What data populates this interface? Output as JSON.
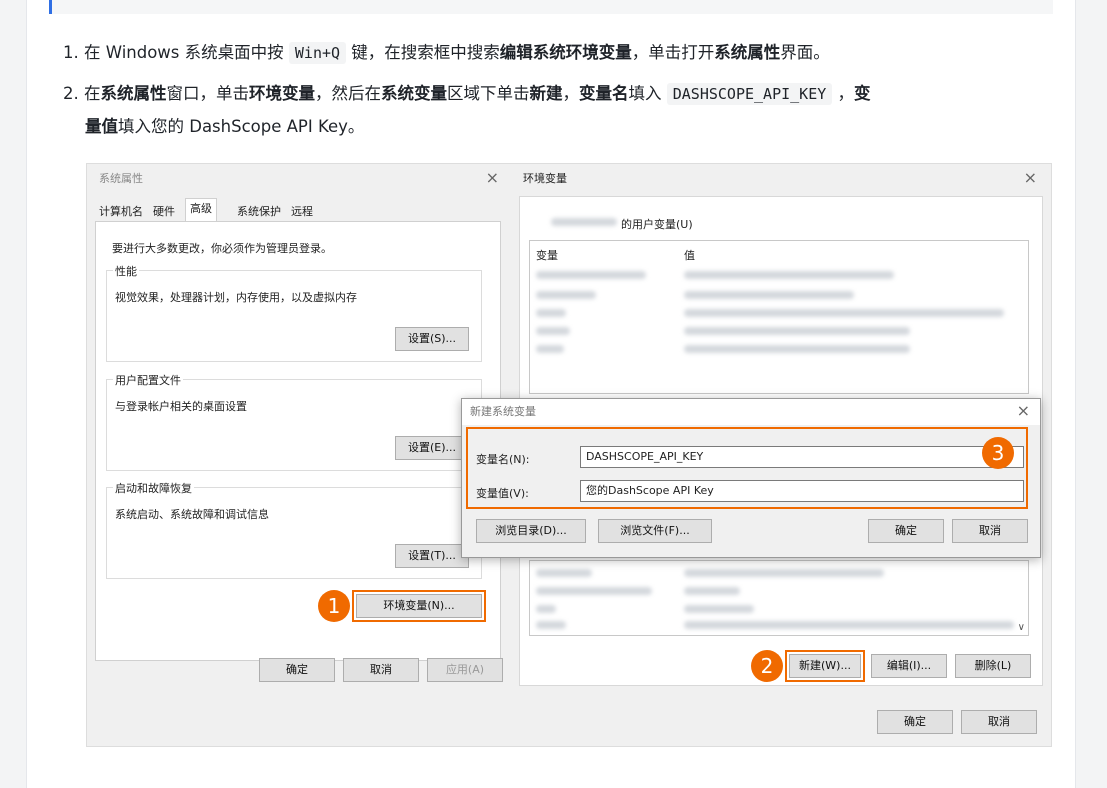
{
  "steps": [
    {
      "num": "1.",
      "p1": "在 Windows 系统桌面中按 ",
      "code": "Win+Q",
      "p2": " 键，在搜索框中搜索",
      "b1": "编辑系统环境变量",
      "p3": "，单击打开",
      "b2": "系统属性",
      "p4": "界面。"
    },
    {
      "num": "2.",
      "p1": "在",
      "b1": "系统属性",
      "p2": "窗口，单击",
      "b2": "环境变量",
      "p3": "，然后在",
      "b3": "系统变量",
      "p4": "区域下单击",
      "b4": "新建",
      "p5": "，",
      "b5": "变量名",
      "p6": "填入 ",
      "code": "DASHSCOPE_API_KEY",
      "p7": " ，",
      "b6": "变",
      "line2b": "量值",
      "line2": "填入您的 DashScope API Key。"
    }
  ],
  "sysprops": {
    "title": "系统属性",
    "tabs": [
      "计算机名",
      "硬件",
      "高级",
      "系统保护",
      "远程"
    ],
    "admin_note": "要进行大多数更改，你必须作为管理员登录。",
    "perf": {
      "title": "性能",
      "desc": "视觉效果，处理器计划，内存使用，以及虚拟内存",
      "btn": "设置(S)..."
    },
    "profile": {
      "title": "用户配置文件",
      "desc": "与登录帐户相关的桌面设置",
      "btn": "设置(E)..."
    },
    "startup": {
      "title": "启动和故障恢复",
      "desc": "系统启动、系统故障和调试信息",
      "btn": "设置(T)..."
    },
    "env_btn": "环境变量(N)...",
    "ok": "确定",
    "cancel": "取消",
    "apply": "应用(A)"
  },
  "envvars": {
    "title": "环境变量",
    "user_vars_suffix": "的用户变量(U)",
    "col_var": "变量",
    "col_val": "值",
    "new_btn": "新建(W)...",
    "edit_btn": "编辑(I)...",
    "delete_btn": "删除(L)",
    "ok": "确定",
    "cancel": "取消"
  },
  "newvar": {
    "title": "新建系统变量",
    "name_label": "变量名(N):",
    "name_value": "DASHSCOPE_API_KEY",
    "value_label": "变量值(V):",
    "value_value": "您的DashScope API Key",
    "browse_dir": "浏览目录(D)...",
    "browse_file": "浏览文件(F)...",
    "ok": "确定",
    "cancel": "取消"
  },
  "badges": [
    "1",
    "2",
    "3"
  ],
  "colors": {
    "accent": "#f06a00",
    "link": "#2f6fe4"
  }
}
